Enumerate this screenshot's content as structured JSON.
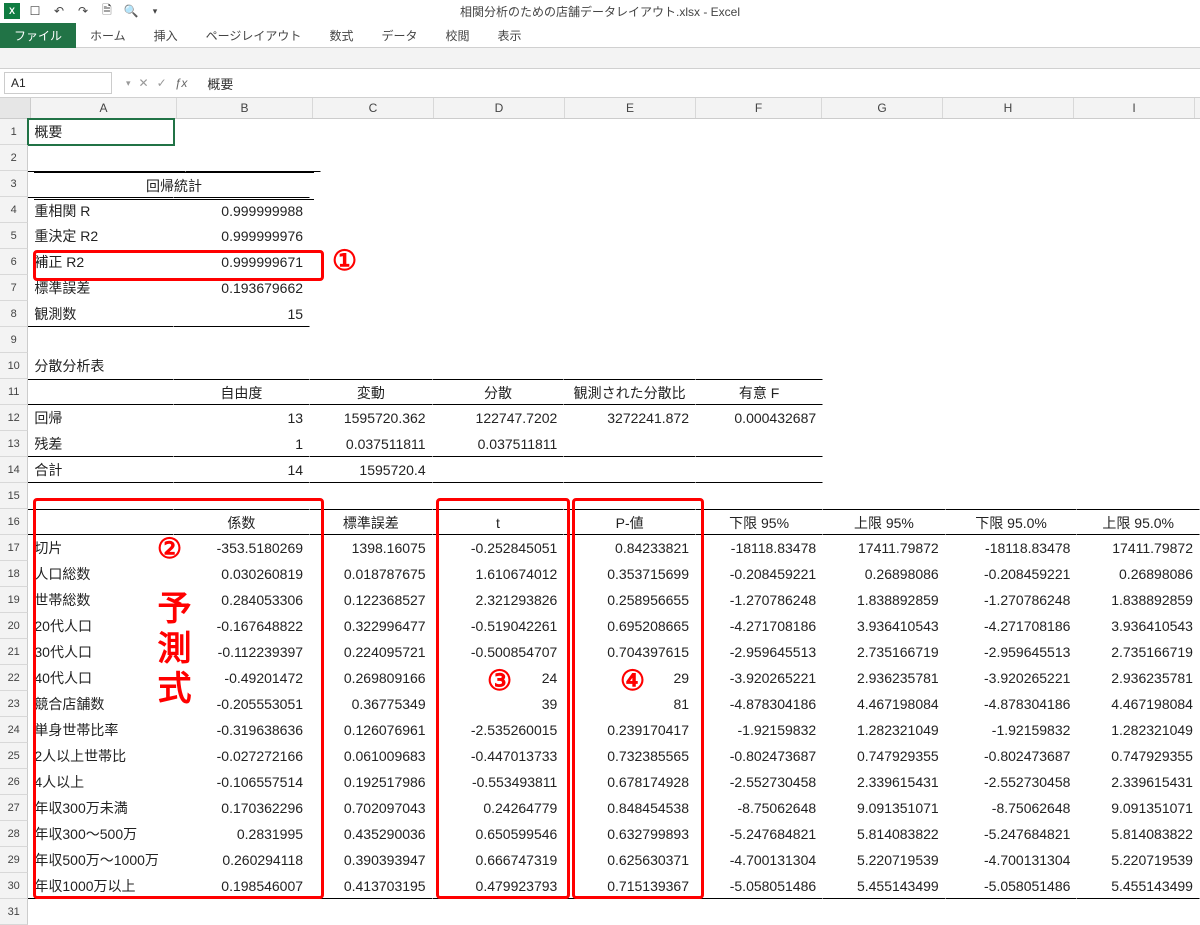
{
  "title": "相関分析のための店舗データレイアウト.xlsx - Excel",
  "qat": {
    "save": "💾",
    "undo": "↶",
    "redo": "↷",
    "new": "🗎",
    "preview": "🔍"
  },
  "tabs": {
    "file": "ファイル",
    "home": "ホーム",
    "insert": "挿入",
    "layout": "ページレイアウト",
    "formulas": "数式",
    "data": "データ",
    "review": "校閲",
    "view": "表示"
  },
  "fbar": {
    "ref": "A1",
    "formula": "概要"
  },
  "cols": [
    "A",
    "B",
    "C",
    "D",
    "E",
    "F",
    "G",
    "H",
    "I"
  ],
  "cells": {
    "r1": {
      "A": "概要"
    },
    "r3": {
      "head": "回帰統計"
    },
    "r4": {
      "A": "重相関 R",
      "B": "0.999999988"
    },
    "r5": {
      "A": "重決定 R2",
      "B": "0.999999976"
    },
    "r6": {
      "A": "補正 R2",
      "B": "0.999999671"
    },
    "r7": {
      "A": "標準誤差",
      "B": "0.193679662"
    },
    "r8": {
      "A": "観測数",
      "B": "15"
    },
    "r10": {
      "A": "分散分析表"
    },
    "r11": {
      "B": "自由度",
      "C": "変動",
      "D": "分散",
      "E": "観測された分散比",
      "F": "有意 F"
    },
    "r12": {
      "A": "回帰",
      "B": "13",
      "C": "1595720.362",
      "D": "122747.7202",
      "E": "3272241.872",
      "F": "0.000432687"
    },
    "r13": {
      "A": "残差",
      "B": "1",
      "C": "0.037511811",
      "D": "0.037511811"
    },
    "r14": {
      "A": "合計",
      "B": "14",
      "C": "1595720.4"
    },
    "r16": {
      "B": "係数",
      "C": "標準誤差",
      "D": "t",
      "E": "P-値",
      "F": "下限 95%",
      "G": "上限 95%",
      "H": "下限 95.0%",
      "I": "上限 95.0%"
    },
    "r17": {
      "A": "切片",
      "B": "-353.5180269",
      "C": "1398.16075",
      "D": "-0.252845051",
      "E": "0.84233821",
      "F": "-18118.83478",
      "G": "17411.79872",
      "H": "-18118.83478",
      "I": "17411.79872"
    },
    "r18": {
      "A": "人口総数",
      "B": "0.030260819",
      "C": "0.018787675",
      "D": "1.610674012",
      "E": "0.353715699",
      "F": "-0.208459221",
      "G": "0.26898086",
      "H": "-0.208459221",
      "I": "0.26898086"
    },
    "r19": {
      "A": "世帯総数",
      "B": "0.284053306",
      "C": "0.122368527",
      "D": "2.321293826",
      "E": "0.258956655",
      "F": "-1.270786248",
      "G": "1.838892859",
      "H": "-1.270786248",
      "I": "1.838892859"
    },
    "r20": {
      "A": "20代人口",
      "B": "-0.167648822",
      "C": "0.322996477",
      "D": "-0.519042261",
      "E": "0.695208665",
      "F": "-4.271708186",
      "G": "3.936410543",
      "H": "-4.271708186",
      "I": "3.936410543"
    },
    "r21": {
      "A": "30代人口",
      "B": "-0.112239397",
      "C": "0.224095721",
      "D": "-0.500854707",
      "E": "0.704397615",
      "F": "-2.959645513",
      "G": "2.735166719",
      "H": "-2.959645513",
      "I": "2.735166719"
    },
    "r22": {
      "A": "40代人口",
      "B": "-0.49201472",
      "C": "0.269809166",
      "D": "24",
      "E": "29",
      "F": "-3.920265221",
      "G": "2.936235781",
      "H": "-3.920265221",
      "I": "2.936235781"
    },
    "r23": {
      "A": "競合店舗数",
      "B": "-0.205553051",
      "C": "0.36775349",
      "D": "39",
      "E": "81",
      "F": "-4.878304186",
      "G": "4.467198084",
      "H": "-4.878304186",
      "I": "4.467198084"
    },
    "r24": {
      "A": "単身世帯比率",
      "B": "-0.319638636",
      "C": "0.126076961",
      "D": "-2.535260015",
      "E": "0.239170417",
      "F": "-1.92159832",
      "G": "1.282321049",
      "H": "-1.92159832",
      "I": "1.282321049"
    },
    "r25": {
      "A": "2人以上世帯比",
      "B": "-0.027272166",
      "C": "0.061009683",
      "D": "-0.447013733",
      "E": "0.732385565",
      "F": "-0.802473687",
      "G": "0.747929355",
      "H": "-0.802473687",
      "I": "0.747929355"
    },
    "r26": {
      "A": "4人以上",
      "B": "-0.106557514",
      "C": "0.192517986",
      "D": "-0.553493811",
      "E": "0.678174928",
      "F": "-2.552730458",
      "G": "2.339615431",
      "H": "-2.552730458",
      "I": "2.339615431"
    },
    "r27": {
      "A": "年収300万未満",
      "B": "0.170362296",
      "C": "0.702097043",
      "D": "0.24264779",
      "E": "0.848454538",
      "F": "-8.75062648",
      "G": "9.091351071",
      "H": "-8.75062648",
      "I": "9.091351071"
    },
    "r28": {
      "A": "年収300～500万",
      "B": "0.2831995",
      "C": "0.435290036",
      "D": "0.650599546",
      "E": "0.632799893",
      "F": "-5.247684821",
      "G": "5.814083822",
      "H": "-5.247684821",
      "I": "5.814083822"
    },
    "r29": {
      "A": "年収500万～1000万",
      "B": "0.260294118",
      "C": "0.390393947",
      "D": "0.666747319",
      "E": "0.625630371",
      "F": "-4.700131304",
      "G": "5.220719539",
      "H": "-4.700131304",
      "I": "5.220719539"
    },
    "r30": {
      "A": "年収1000万以上",
      "B": "0.198546007",
      "C": "0.413703195",
      "D": "0.479923793",
      "E": "0.715139367",
      "F": "-5.058051486",
      "G": "5.455143499",
      "H": "-5.058051486",
      "I": "5.455143499"
    }
  },
  "annotations": {
    "one": "①",
    "two": "②",
    "three": "③",
    "four": "④",
    "yosoku": "予測式"
  }
}
